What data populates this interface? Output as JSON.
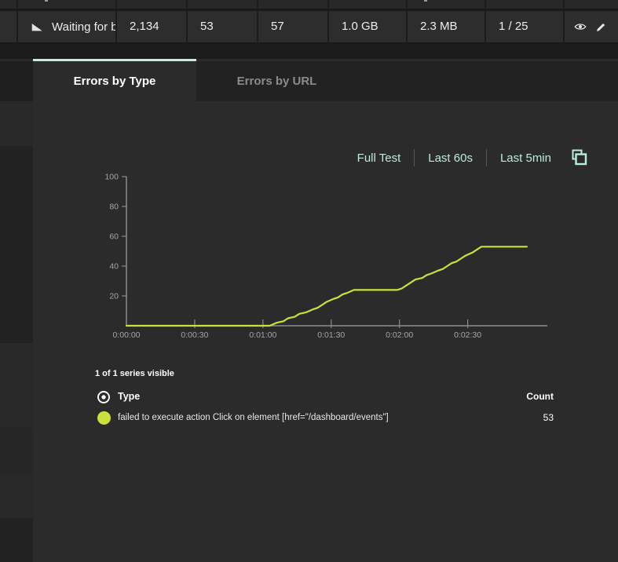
{
  "colors": {
    "accent_teal": "#b9ece1",
    "tab_underline": "#bdeee4",
    "series_line": "#cbe03d",
    "row_bg": "#2d2d2d",
    "content_bg": "#2b2b2b"
  },
  "table": {
    "row": {
      "icon": "flag-icon",
      "name": "Waiting for b",
      "cells": [
        "2,134",
        "53",
        "57",
        "1.0 GB",
        "2.3 MB",
        "1 / 25"
      ],
      "action_icons": [
        "eye-icon",
        "pencil-icon"
      ]
    }
  },
  "tabs": [
    {
      "label": "Errors by Type",
      "active": true
    },
    {
      "label": "Errors by URL",
      "active": false
    }
  ],
  "time_range": {
    "options": [
      "Full Test",
      "Last 60s",
      "Last 5min"
    ],
    "icon": "copy-icon"
  },
  "chart_data": {
    "type": "line",
    "title": "",
    "xlabel": "",
    "ylabel": "",
    "ylim": [
      0,
      100
    ],
    "y_ticks": [
      20,
      40,
      60,
      80,
      100
    ],
    "x_ticks": [
      "0:00:00",
      "0:00:30",
      "0:01:00",
      "0:01:30",
      "0:02:00",
      "0:02:30"
    ],
    "x_tick_seconds": 30,
    "x_max_seconds": 185,
    "grid": false,
    "legend_position": "below",
    "series": [
      {
        "name": "failed to execute action Click on element [href=\"/dashboard/events\"]",
        "color": "#cbe03d",
        "points": [
          [
            0,
            0
          ],
          [
            63,
            0
          ],
          [
            66,
            2
          ],
          [
            69,
            3
          ],
          [
            71,
            5
          ],
          [
            74,
            6
          ],
          [
            76,
            8
          ],
          [
            79,
            9
          ],
          [
            82,
            11
          ],
          [
            84,
            12
          ],
          [
            86,
            14
          ],
          [
            88,
            16
          ],
          [
            91,
            18
          ],
          [
            93,
            19
          ],
          [
            95,
            21
          ],
          [
            97,
            22
          ],
          [
            100,
            24
          ],
          [
            119,
            24
          ],
          [
            121,
            25
          ],
          [
            123,
            27
          ],
          [
            125,
            29
          ],
          [
            127,
            31
          ],
          [
            130,
            32
          ],
          [
            132,
            34
          ],
          [
            134,
            35
          ],
          [
            137,
            37
          ],
          [
            139,
            38
          ],
          [
            141,
            40
          ],
          [
            143,
            42
          ],
          [
            145,
            43
          ],
          [
            147,
            45
          ],
          [
            149,
            47
          ],
          [
            152,
            49
          ],
          [
            154,
            51
          ],
          [
            156,
            53
          ],
          [
            176,
            53
          ]
        ]
      }
    ]
  },
  "legend": {
    "summary": "1 of 1 series visible",
    "columns": {
      "type": "Type",
      "count": "Count"
    },
    "rows": [
      {
        "label": "failed to execute action Click on element [href=\"/dashboard/events\"]",
        "count": "53",
        "color": "#cbe03d"
      }
    ]
  }
}
